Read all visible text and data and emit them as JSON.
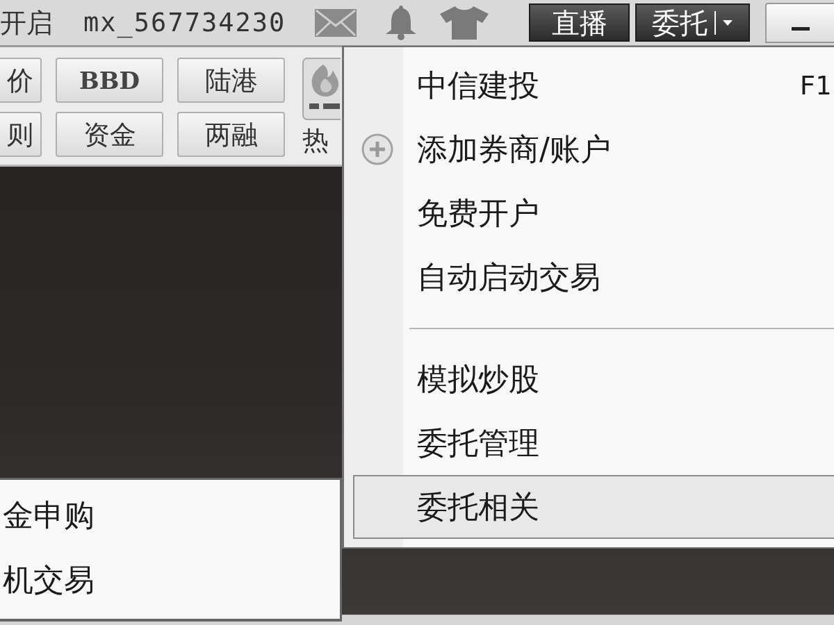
{
  "top_bar": {
    "status_text": "开启",
    "username": "mx_567734230",
    "buttons": [
      {
        "label": "直播",
        "kind": "plain"
      },
      {
        "label": "委托",
        "kind": "dropdown"
      }
    ]
  },
  "toolbar": {
    "rows": [
      [
        {
          "label": "价",
          "kind": "text"
        },
        {
          "label": "BBD",
          "kind": "abbreviation"
        },
        {
          "label": "陆港",
          "kind": "text"
        }
      ],
      [
        {
          "label": "则",
          "kind": "text"
        },
        {
          "label": "资金",
          "kind": "text"
        },
        {
          "label": "两融",
          "kind": "text"
        }
      ]
    ],
    "hot": {
      "label": "热"
    }
  },
  "dropdown_menu": {
    "items": [
      {
        "kind": "item",
        "label": "中信建投",
        "shortcut": "F1",
        "selected": false
      },
      {
        "kind": "add",
        "label": "添加券商/账户",
        "selected": false
      },
      {
        "kind": "item",
        "label": "免费开户",
        "selected": false
      },
      {
        "kind": "item",
        "label": "自动启动交易",
        "selected": false
      },
      {
        "kind": "separator"
      },
      {
        "kind": "item",
        "label": "模拟炒股",
        "selected": false
      },
      {
        "kind": "item",
        "label": "委托管理",
        "selected": false
      },
      {
        "kind": "item",
        "label": "委托相关",
        "selected": true
      }
    ]
  },
  "popup_menu": {
    "items": [
      {
        "label": "金申购"
      },
      {
        "label": "机交易"
      }
    ]
  }
}
